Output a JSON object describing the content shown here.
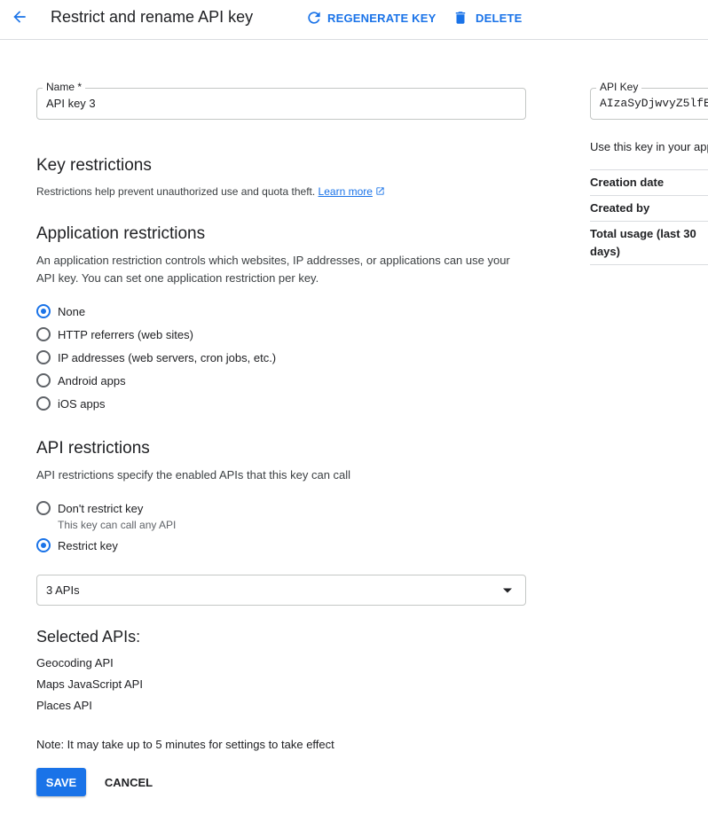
{
  "header": {
    "title": "Restrict and rename API key",
    "regenerate_label": "REGENERATE KEY",
    "delete_label": "DELETE"
  },
  "name_field": {
    "label": "Name *",
    "value": "API key 3"
  },
  "key_restrictions": {
    "heading": "Key restrictions",
    "description": "Restrictions help prevent unauthorized use and quota theft.",
    "learn_more": "Learn more"
  },
  "application_restrictions": {
    "heading": "Application restrictions",
    "description": "An application restriction controls which websites, IP addresses, or applications can use your API key. You can set one application restriction per key.",
    "options": [
      {
        "label": "None",
        "checked": true
      },
      {
        "label": "HTTP referrers (web sites)",
        "checked": false
      },
      {
        "label": "IP addresses (web servers, cron jobs, etc.)",
        "checked": false
      },
      {
        "label": "Android apps",
        "checked": false
      },
      {
        "label": "iOS apps",
        "checked": false
      }
    ]
  },
  "api_restrictions": {
    "heading": "API restrictions",
    "description": "API restrictions specify the enabled APIs that this key can call",
    "options": [
      {
        "label": "Don't restrict key",
        "sublabel": "This key can call any API",
        "checked": false
      },
      {
        "label": "Restrict key",
        "checked": true
      }
    ],
    "select_value": "3 APIs"
  },
  "selected_apis": {
    "heading": "Selected APIs:",
    "items": [
      "Geocoding API",
      "Maps JavaScript API",
      "Places API"
    ]
  },
  "note": "Note: It may take up to 5 minutes for settings to take effect",
  "actions": {
    "save_label": "SAVE",
    "cancel_label": "CANCEL"
  },
  "right_panel": {
    "api_key_label": "API Key",
    "api_key_value": "AIzaSyDjwvyZ5lfE",
    "use_text": "Use this key in your app",
    "info_rows": [
      "Creation date",
      "Created by",
      "Total usage (last 30 days)"
    ]
  },
  "colors": {
    "accent": "#1a73e8",
    "border": "#dadce0"
  }
}
